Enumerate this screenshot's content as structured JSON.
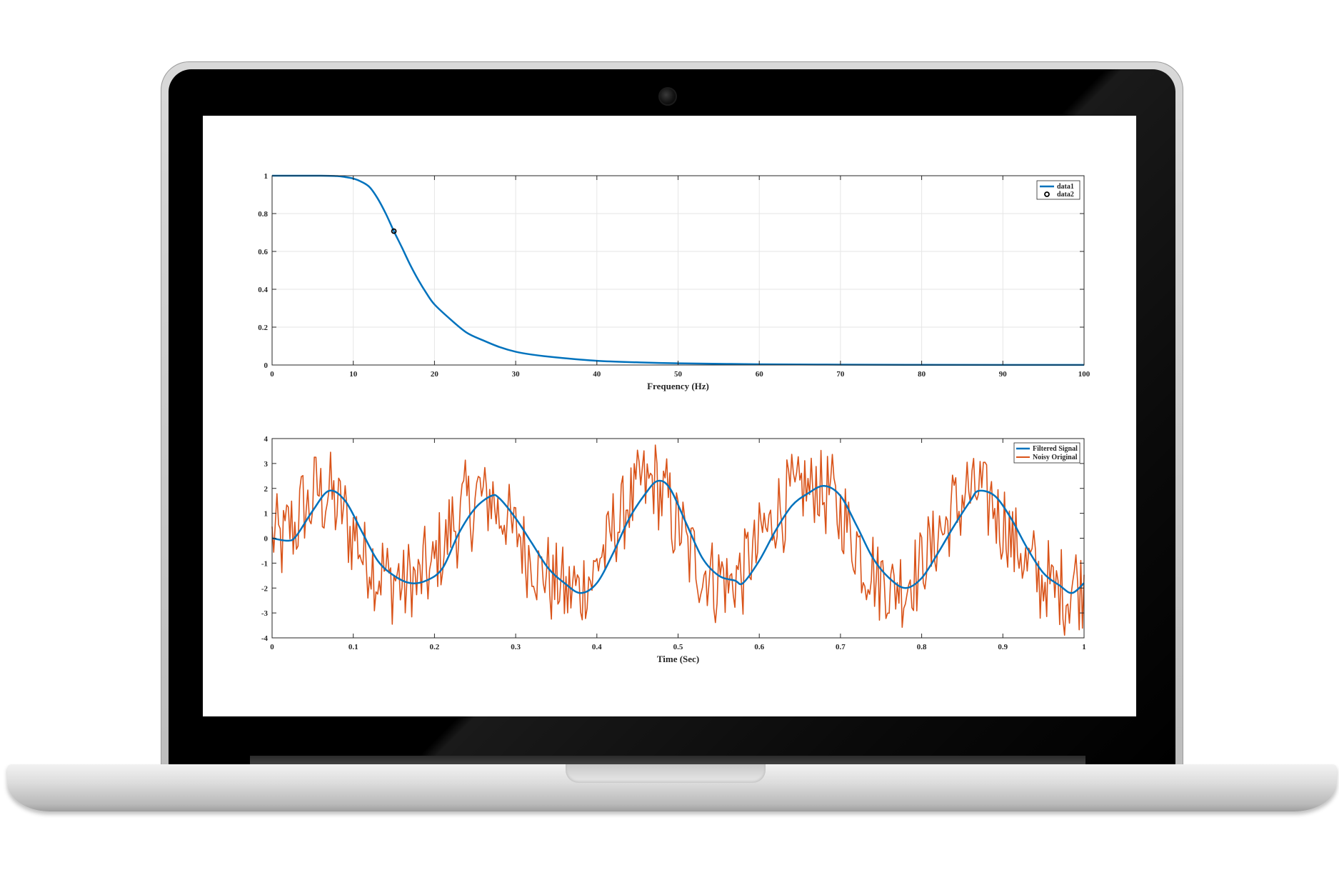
{
  "colors": {
    "blue": "#0072BD",
    "orange": "#D95319",
    "grid": "#E6E6E6",
    "axis": "#262626"
  },
  "chart_data": [
    {
      "type": "line",
      "xlabel": "Frequency (Hz)",
      "ylabel": "",
      "xlim": [
        0,
        100
      ],
      "ylim": [
        0,
        1
      ],
      "xticks": [
        "0",
        "10",
        "20",
        "30",
        "40",
        "50",
        "60",
        "70",
        "80",
        "90",
        "100"
      ],
      "yticks": [
        "0",
        "0.2",
        "0.4",
        "0.6",
        "0.8",
        "1"
      ],
      "grid": true,
      "legend_position": "top-right",
      "series": [
        {
          "name": "data1",
          "style": "line",
          "x": [
            0,
            2,
            4,
            6,
            8,
            9,
            10,
            11,
            12,
            13,
            14,
            15,
            16,
            17,
            18,
            19,
            20,
            22,
            24,
            26,
            28,
            30,
            32,
            35,
            40,
            45,
            50,
            60,
            70,
            80,
            90,
            100
          ],
          "y": [
            1.0,
            1.0,
            1.0,
            1.0,
            0.998,
            0.993,
            0.985,
            0.968,
            0.94,
            0.88,
            0.8,
            0.707,
            0.62,
            0.53,
            0.45,
            0.38,
            0.32,
            0.24,
            0.17,
            0.13,
            0.095,
            0.07,
            0.055,
            0.04,
            0.022,
            0.014,
            0.009,
            0.004,
            0.002,
            0.001,
            0.0005,
            0.0003
          ]
        },
        {
          "name": "data2",
          "style": "marker",
          "x": [
            15
          ],
          "y": [
            0.707
          ]
        }
      ]
    },
    {
      "type": "line",
      "xlabel": "Time (Sec)",
      "ylabel": "",
      "xlim": [
        0,
        1
      ],
      "ylim": [
        -4,
        4
      ],
      "xticks": [
        "0",
        "0.1",
        "0.2",
        "0.3",
        "0.4",
        "0.5",
        "0.6",
        "0.7",
        "0.8",
        "0.9",
        "1"
      ],
      "yticks": [
        "-4",
        "-3",
        "-2",
        "-1",
        "0",
        "1",
        "2",
        "3",
        "4"
      ],
      "grid": false,
      "legend_position": "top-right",
      "series": [
        {
          "name": "Filtered Signal",
          "style": "line",
          "x": [
            0,
            0.02,
            0.03,
            0.05,
            0.07,
            0.09,
            0.11,
            0.13,
            0.15,
            0.17,
            0.19,
            0.21,
            0.23,
            0.25,
            0.27,
            0.28,
            0.3,
            0.32,
            0.34,
            0.36,
            0.38,
            0.4,
            0.42,
            0.44,
            0.46,
            0.475,
            0.49,
            0.51,
            0.53,
            0.55,
            0.57,
            0.58,
            0.6,
            0.62,
            0.64,
            0.66,
            0.68,
            0.7,
            0.72,
            0.74,
            0.76,
            0.78,
            0.8,
            0.82,
            0.84,
            0.86,
            0.87,
            0.89,
            0.91,
            0.93,
            0.95,
            0.97,
            0.985,
            1.0
          ],
          "y": [
            0,
            -0.1,
            0.1,
            1.1,
            1.9,
            1.5,
            0.3,
            -0.9,
            -1.5,
            -1.8,
            -1.7,
            -1.2,
            0.2,
            1.2,
            1.7,
            1.6,
            0.8,
            -0.2,
            -1.2,
            -1.8,
            -2.2,
            -1.8,
            -0.6,
            0.8,
            1.8,
            2.3,
            2.0,
            0.6,
            -0.8,
            -1.5,
            -1.7,
            -1.8,
            -0.9,
            0.3,
            1.3,
            1.8,
            2.1,
            1.7,
            0.5,
            -0.8,
            -1.6,
            -2.0,
            -1.6,
            -0.6,
            0.5,
            1.5,
            1.9,
            1.7,
            0.8,
            -0.4,
            -1.4,
            -1.9,
            -2.2,
            -1.8
          ]
        },
        {
          "name": "Noisy Original",
          "style": "line",
          "generated": true
        }
      ]
    }
  ]
}
